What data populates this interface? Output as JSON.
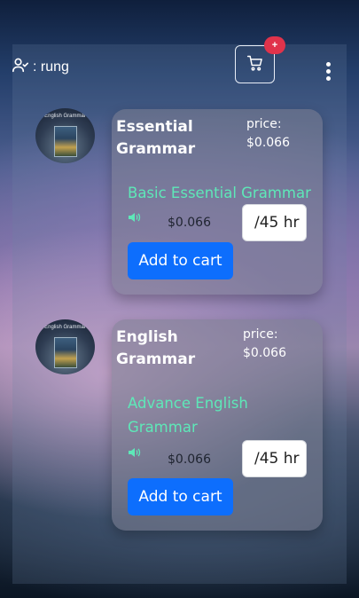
{
  "header": {
    "user_label": ": rung",
    "cart_badge": "+",
    "icons": {
      "user": "user-check-icon",
      "cart": "cart-icon",
      "menu": "more-vertical-icon"
    }
  },
  "products": [
    {
      "avatar_text": "English Grammar",
      "name": "Essential Grammar",
      "price_label": "price:",
      "price": "$0.066",
      "course_title": "Basic Essential Grammar",
      "course_price": "$0.066",
      "hours_value": "/45 hr",
      "add_label": "Add to cart"
    },
    {
      "avatar_text": "English Grammar",
      "name": "English Grammar",
      "price_label": "price:",
      "price": "$0.066",
      "course_title": "Advance English Grammar",
      "course_price": "$0.066",
      "hours_value": "/45 hr",
      "add_label": "Add to cart"
    }
  ],
  "colors": {
    "accent_button": "#0d6efd",
    "course_title": "#5ee8b8",
    "badge": "#e0334b"
  }
}
